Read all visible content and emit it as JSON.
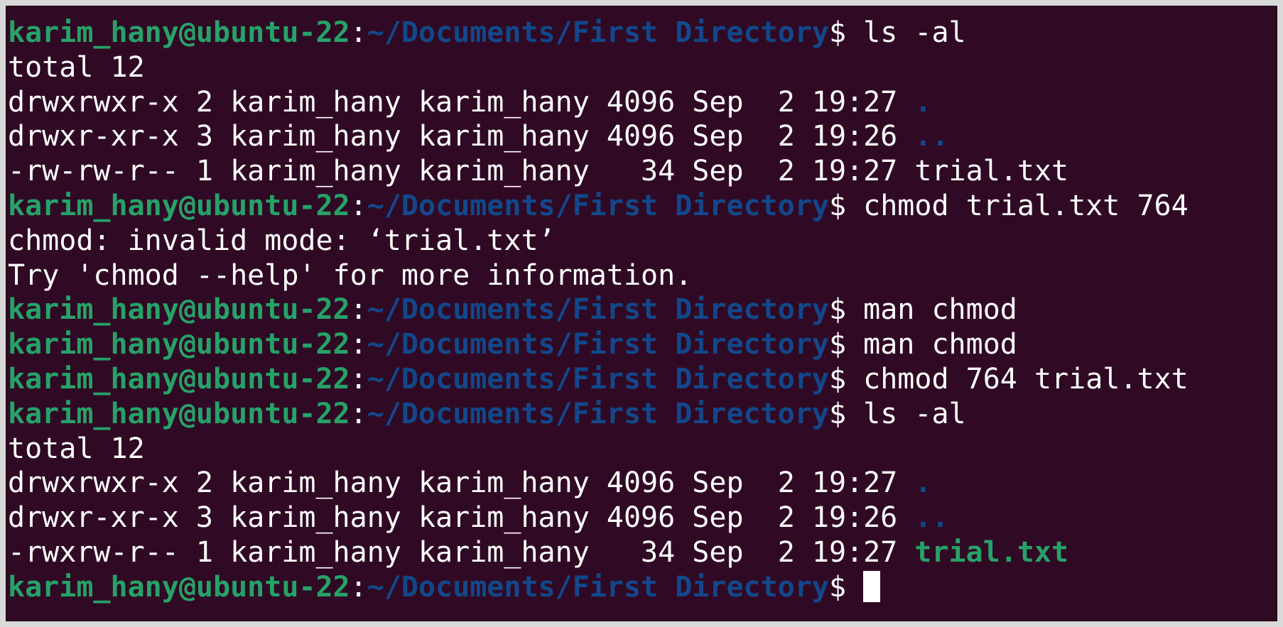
{
  "terminal": {
    "colors": {
      "background": "#300a24",
      "prompt_user": "#26a269",
      "prompt_path": "#12488b",
      "text": "#ffffff",
      "executable": "#26a269",
      "directory": "#12488b"
    },
    "prompt": {
      "user_host": "karim_hany@ubuntu-22",
      "separator": ":",
      "path": "~/Documents/First Directory",
      "symbol": "$ "
    },
    "lines": [
      {
        "type": "prompt",
        "command": "ls -al"
      },
      {
        "type": "output",
        "text": "total 12"
      },
      {
        "type": "listing",
        "text": "drwxrwxr-x 2 karim_hany karim_hany 4096 Sep  2 19:27 ",
        "name": ".",
        "name_style": "dir"
      },
      {
        "type": "listing",
        "text": "drwxr-xr-x 3 karim_hany karim_hany 4096 Sep  2 19:26 ",
        "name": "..",
        "name_style": "dir"
      },
      {
        "type": "listing",
        "text": "-rw-rw-r-- 1 karim_hany karim_hany   34 Sep  2 19:27 ",
        "name": "trial.txt",
        "name_style": "plain"
      },
      {
        "type": "prompt",
        "command": "chmod trial.txt 764"
      },
      {
        "type": "output",
        "text": "chmod: invalid mode: ‘trial.txt’"
      },
      {
        "type": "output",
        "text": "Try 'chmod --help' for more information."
      },
      {
        "type": "prompt",
        "command": "man chmod"
      },
      {
        "type": "prompt",
        "command": "man chmod"
      },
      {
        "type": "prompt",
        "command": "chmod 764 trial.txt"
      },
      {
        "type": "prompt",
        "command": "ls -al"
      },
      {
        "type": "output",
        "text": "total 12"
      },
      {
        "type": "listing",
        "text": "drwxrwxr-x 2 karim_hany karim_hany 4096 Sep  2 19:27 ",
        "name": ".",
        "name_style": "dir"
      },
      {
        "type": "listing",
        "text": "drwxr-xr-x 3 karim_hany karim_hany 4096 Sep  2 19:26 ",
        "name": "..",
        "name_style": "dir"
      },
      {
        "type": "listing",
        "text": "-rwxrw-r-- 1 karim_hany karim_hany   34 Sep  2 19:27 ",
        "name": "trial.txt",
        "name_style": "exec"
      },
      {
        "type": "prompt",
        "command": "",
        "cursor": true
      }
    ]
  }
}
